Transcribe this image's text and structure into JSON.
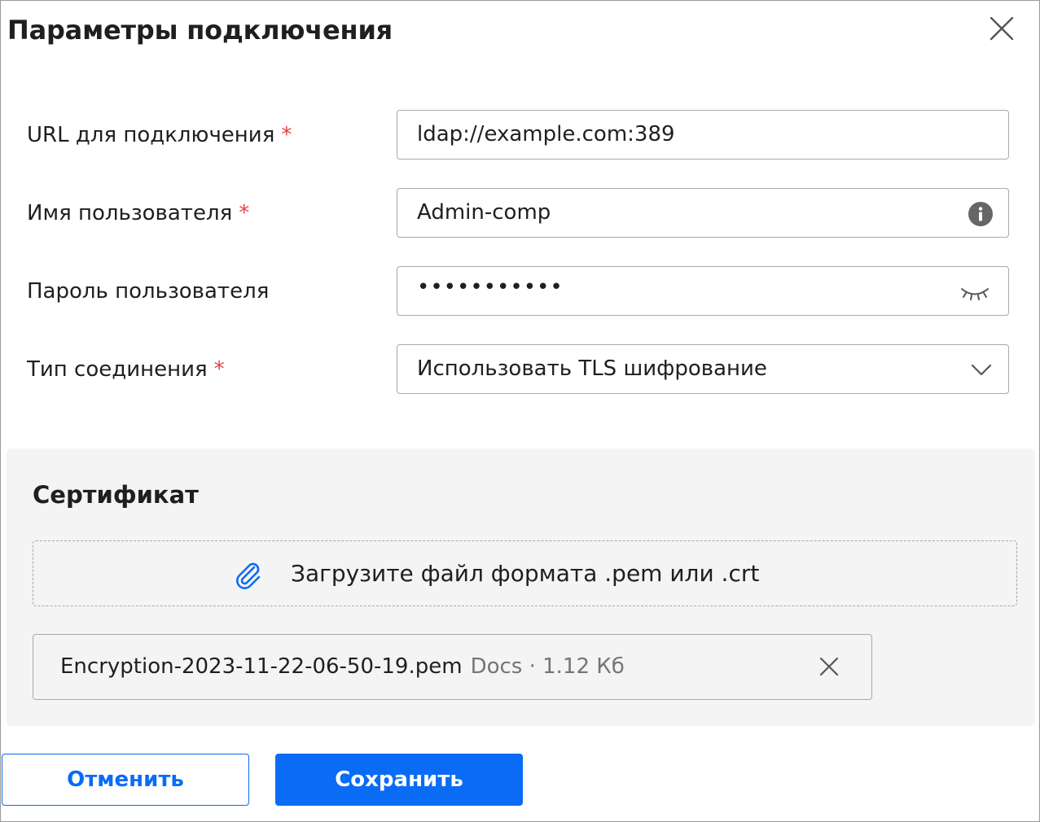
{
  "dialog": {
    "title": "Параметры подключения"
  },
  "fields": {
    "url": {
      "label": "URL для подключения",
      "required_mark": "*",
      "value": "ldap://example.com:389"
    },
    "username": {
      "label": "Имя пользователя",
      "required_mark": "*",
      "value": "Admin-comp",
      "icon": "info-icon"
    },
    "password": {
      "label": "Пароль пользователя",
      "masked_value": "•••••••••••",
      "icon": "eye-closed-icon"
    },
    "connection_type": {
      "label": "Тип соединения",
      "required_mark": "*",
      "selected": "Использовать TLS шифрование",
      "icon": "chevron-down-icon"
    }
  },
  "certificate": {
    "title": "Сертификат",
    "upload_text": "Загрузите файл формата .pem или .crt",
    "upload_icon": "paperclip-icon",
    "file": {
      "name": "Encryption-2023-11-22-06-50-19.pem",
      "meta": "Docs · 1.12 Кб"
    }
  },
  "buttons": {
    "cancel": "Отменить",
    "save": "Сохранить"
  },
  "colors": {
    "accent": "#0a6cf5",
    "required": "#e04545",
    "panel_bg": "#f4f4f4",
    "border": "#a9a9a9"
  }
}
